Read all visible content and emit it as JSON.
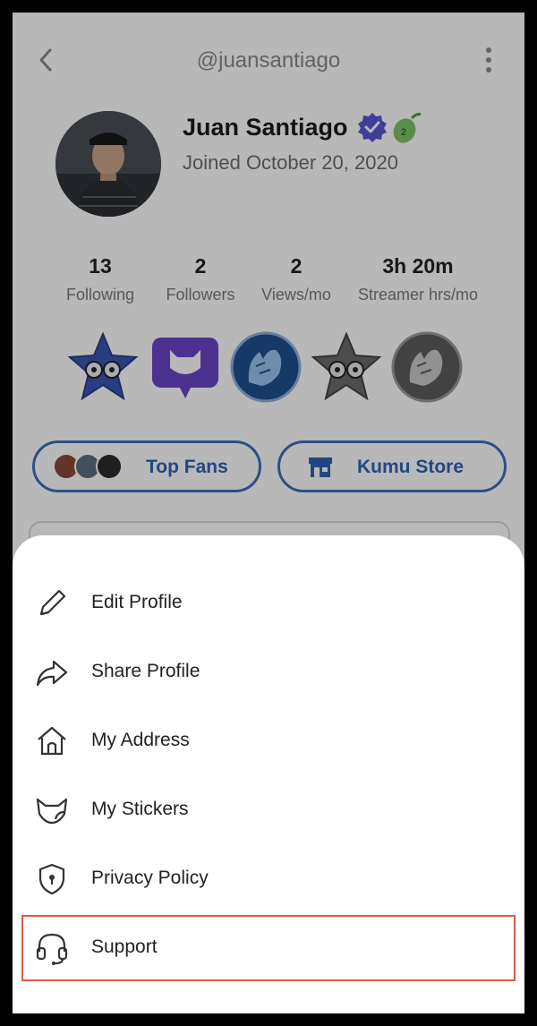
{
  "header": {
    "handle": "@juansantiago"
  },
  "profile": {
    "name": "Juan Santiago",
    "joined": "Joined October 20, 2020"
  },
  "stats": [
    {
      "value": "13",
      "label": "Following"
    },
    {
      "value": "2",
      "label": "Followers"
    },
    {
      "value": "2",
      "label": "Views/mo"
    },
    {
      "value": "3h 20m",
      "label": "Streamer hrs/mo"
    }
  ],
  "buttons": {
    "top_fans": "Top Fans",
    "kumu_store": "Kumu Store"
  },
  "menu": {
    "items": [
      {
        "label": "Edit Profile",
        "icon": "pencil-icon"
      },
      {
        "label": "Share Profile",
        "icon": "share-arrow-icon"
      },
      {
        "label": "My Address",
        "icon": "home-icon"
      },
      {
        "label": "My Stickers",
        "icon": "sticker-icon"
      },
      {
        "label": "Privacy Policy",
        "icon": "shield-icon"
      },
      {
        "label": "Support",
        "icon": "headset-icon"
      }
    ]
  },
  "colors": {
    "accent": "#2f63b4",
    "highlight": "#e05a47",
    "badge_purple": "#6a45c8"
  }
}
